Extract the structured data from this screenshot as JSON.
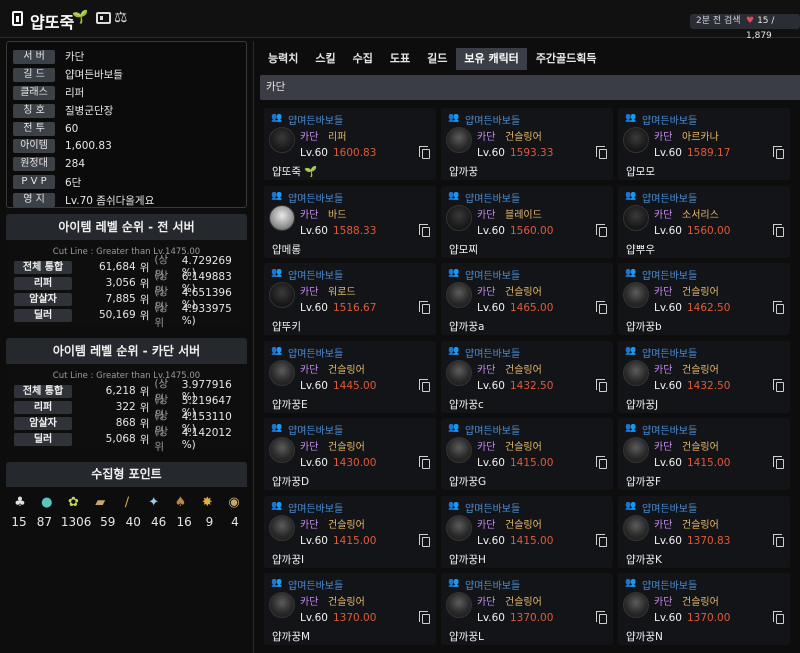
{
  "header": {
    "name": "얍또죽",
    "leaf_icon": "🌱",
    "scale_icon": "⚖",
    "search_badge": "2분 전 검색",
    "like_count": "15 / 1,879"
  },
  "info": [
    {
      "label": "서  버",
      "value": "카단"
    },
    {
      "label": "길  드",
      "value": "얍며든바보들"
    },
    {
      "label": "클래스",
      "value": "리퍼"
    },
    {
      "label": "칭  호",
      "value": "질병군단장"
    },
    {
      "label": "전  투",
      "value": "60"
    },
    {
      "label": "아이템",
      "value": "1,600.83"
    },
    {
      "label": "원정대",
      "value": "284"
    },
    {
      "label": "P V P",
      "value": "6단"
    },
    {
      "label": "영  지",
      "value": "Lv.70 좀쉬다올게요"
    }
  ],
  "rank_all": {
    "title": "아이템 레벨 순위 - 전 서버",
    "cutline": "Cut Line : Greater than Lv.1475.00",
    "rows": [
      {
        "label": "전체 통합",
        "num": "61,684",
        "unit": "위",
        "top": "(상위",
        "pct": "4.729269 %)"
      },
      {
        "label": "리퍼",
        "num": "3,056",
        "unit": "위",
        "top": "(상위",
        "pct": "6.149883 %)"
      },
      {
        "label": "암살자",
        "num": "7,885",
        "unit": "위",
        "top": "(상위",
        "pct": "4.651396 %)"
      },
      {
        "label": "딜러",
        "num": "50,169",
        "unit": "위",
        "top": "(상위",
        "pct": "4.933975 %)"
      }
    ]
  },
  "rank_server": {
    "title": "아이템 레벨 순위 - 카단 서버",
    "cutline": "Cut Line : Greater than Lv.1475.00",
    "rows": [
      {
        "label": "전체 통합",
        "num": "6,218",
        "unit": "위",
        "top": "(상위",
        "pct": "3.977916 %)"
      },
      {
        "label": "리퍼",
        "num": "322",
        "unit": "위",
        "top": "(상위",
        "pct": "5.219647 %)"
      },
      {
        "label": "암살자",
        "num": "868",
        "unit": "위",
        "top": "(상위",
        "pct": "4.153110 %)"
      },
      {
        "label": "딜러",
        "num": "5,068",
        "unit": "위",
        "top": "(상위",
        "pct": "4.142012 %)"
      }
    ]
  },
  "collect": {
    "title": "수집형 포인트",
    "values": [
      "15",
      "87",
      "1306",
      "59",
      "40",
      "46",
      "16",
      "9",
      "4"
    ]
  },
  "tabs": [
    "능력치",
    "스킬",
    "수집",
    "도표",
    "길드",
    "보유 캐릭터",
    "주간골드획득"
  ],
  "active_tab": 5,
  "server_bar": "카단",
  "characters": [
    {
      "guild": "얍며든바보들",
      "server": "카단",
      "cls": "리퍼",
      "lv": "Lv.60",
      "ilvl": "1600.83",
      "name": "얍또죽",
      "em": "🌱",
      "av": "dark"
    },
    {
      "guild": "얍며든바보들",
      "server": "카단",
      "cls": "건슬링어",
      "lv": "Lv.60",
      "ilvl": "1593.33",
      "name": "얍까꿍",
      "em": "",
      "av": "mid"
    },
    {
      "guild": "얍며든바보들",
      "server": "카단",
      "cls": "아르카나",
      "lv": "Lv.60",
      "ilvl": "1589.17",
      "name": "얍모모",
      "em": "",
      "av": "dark"
    },
    {
      "guild": "얍며든바보들",
      "server": "카단",
      "cls": "바드",
      "lv": "Lv.60",
      "ilvl": "1588.33",
      "name": "얍메롱",
      "em": "",
      "av": "light"
    },
    {
      "guild": "얍며든바보들",
      "server": "카단",
      "cls": "블레이드",
      "lv": "Lv.60",
      "ilvl": "1560.00",
      "name": "얍모찌",
      "em": "",
      "av": "dark"
    },
    {
      "guild": "얍며든바보들",
      "server": "카단",
      "cls": "소서리스",
      "lv": "Lv.60",
      "ilvl": "1560.00",
      "name": "얍뿌우",
      "em": "",
      "av": "dark"
    },
    {
      "guild": "얍며든바보들",
      "server": "카단",
      "cls": "워로드",
      "lv": "Lv.60",
      "ilvl": "1516.67",
      "name": "얍뚜키",
      "em": "",
      "av": "dark"
    },
    {
      "guild": "얍며든바보들",
      "server": "카단",
      "cls": "건슬링어",
      "lv": "Lv.60",
      "ilvl": "1465.00",
      "name": "얍까꿍a",
      "em": "",
      "av": "mid"
    },
    {
      "guild": "얍며든바보들",
      "server": "카단",
      "cls": "건슬링어",
      "lv": "Lv.60",
      "ilvl": "1462.50",
      "name": "얍까꿍b",
      "em": "",
      "av": "mid"
    },
    {
      "guild": "얍며든바보들",
      "server": "카단",
      "cls": "건슬링어",
      "lv": "Lv.60",
      "ilvl": "1445.00",
      "name": "얍까꿍E",
      "em": "",
      "av": "mid"
    },
    {
      "guild": "얍며든바보들",
      "server": "카단",
      "cls": "건슬링어",
      "lv": "Lv.60",
      "ilvl": "1432.50",
      "name": "얍까꿍c",
      "em": "",
      "av": "mid"
    },
    {
      "guild": "얍며든바보들",
      "server": "카단",
      "cls": "건슬링어",
      "lv": "Lv.60",
      "ilvl": "1432.50",
      "name": "얍까꿍J",
      "em": "",
      "av": "mid"
    },
    {
      "guild": "얍며든바보들",
      "server": "카단",
      "cls": "건슬링어",
      "lv": "Lv.60",
      "ilvl": "1430.00",
      "name": "얍까꿍D",
      "em": "",
      "av": "mid"
    },
    {
      "guild": "얍며든바보들",
      "server": "카단",
      "cls": "건슬링어",
      "lv": "Lv.60",
      "ilvl": "1415.00",
      "name": "얍까꿍G",
      "em": "",
      "av": "mid"
    },
    {
      "guild": "얍며든바보들",
      "server": "카단",
      "cls": "건슬링어",
      "lv": "Lv.60",
      "ilvl": "1415.00",
      "name": "얍까꿍F",
      "em": "",
      "av": "mid"
    },
    {
      "guild": "얍며든바보들",
      "server": "카단",
      "cls": "건슬링어",
      "lv": "Lv.60",
      "ilvl": "1415.00",
      "name": "얍까꿍I",
      "em": "",
      "av": "mid"
    },
    {
      "guild": "얍며든바보들",
      "server": "카단",
      "cls": "건슬링어",
      "lv": "Lv.60",
      "ilvl": "1415.00",
      "name": "얍까꿍H",
      "em": "",
      "av": "mid"
    },
    {
      "guild": "얍며든바보들",
      "server": "카단",
      "cls": "건슬링어",
      "lv": "Lv.60",
      "ilvl": "1370.83",
      "name": "얍까꿍K",
      "em": "",
      "av": "mid"
    },
    {
      "guild": "얍며든바보들",
      "server": "카단",
      "cls": "건슬링어",
      "lv": "Lv.60",
      "ilvl": "1370.00",
      "name": "얍까꿍M",
      "em": "",
      "av": "mid"
    },
    {
      "guild": "얍며든바보들",
      "server": "카단",
      "cls": "건슬링어",
      "lv": "Lv.60",
      "ilvl": "1370.00",
      "name": "얍까꿍L",
      "em": "",
      "av": "mid"
    },
    {
      "guild": "얍며든바보들",
      "server": "카단",
      "cls": "건슬링어",
      "lv": "Lv.60",
      "ilvl": "1370.00",
      "name": "얍까꿍N",
      "em": "",
      "av": "mid"
    }
  ]
}
